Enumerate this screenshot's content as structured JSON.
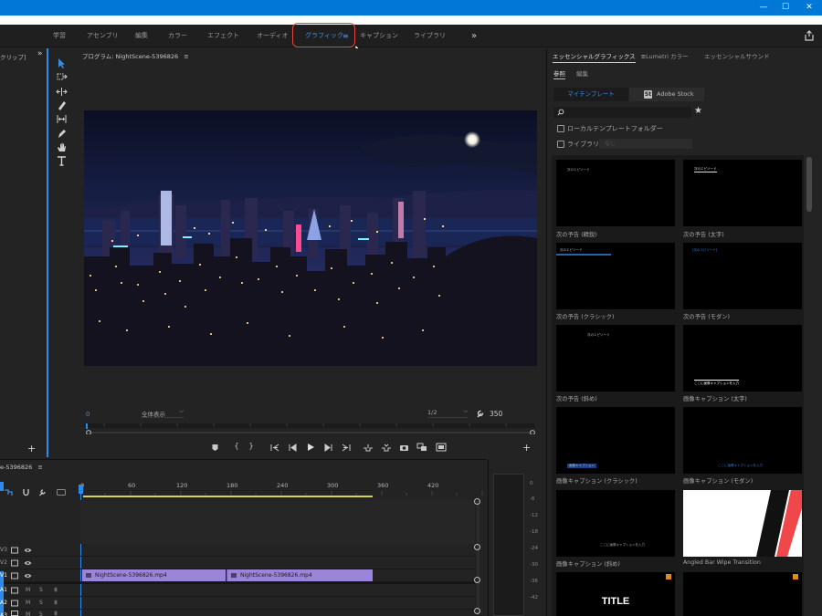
{
  "window": {
    "minimize": "—",
    "maximize": "☐",
    "close": "✕"
  },
  "workspaces": {
    "items": [
      "学習",
      "アセンブリ",
      "編集",
      "カラー",
      "エフェクト",
      "オーディオ",
      "グラフィック",
      "キャプション",
      "ライブラリ"
    ],
    "active_index": 6,
    "active_menu_glyph": "≡",
    "more": "»"
  },
  "project": {
    "title": "クリップ]",
    "more": "»",
    "add": "+"
  },
  "program": {
    "title": "プログラム: NightScene-5396826",
    "menu_glyph": "≡",
    "timecode": "0",
    "fit": "全体表示",
    "resolution": "1/2",
    "frames": "350",
    "add": "+"
  },
  "essential_graphics": {
    "tabs": [
      "エッセンシャルグラフィックス",
      "Lumetri カラー",
      "エッセンシャルサウンド"
    ],
    "tab_menu_glyph": "≡",
    "subtabs": [
      "参照",
      "編集"
    ],
    "my_templates": "マイテンプレート",
    "adobe_stock": "Adobe Stock",
    "stock_letter": "St",
    "local_folder": "ローカルテンプレートフォルダー",
    "libraries": "ライブラリ",
    "library_placeholder": "なし",
    "templates": [
      {
        "label": "次の予告 (精鋭)",
        "inner": "次のエピソード"
      },
      {
        "label": "次の予告 (太字)",
        "inner": "次のエピソード"
      },
      {
        "label": "次の予告 (クラシック)",
        "inner": "次のエピソード"
      },
      {
        "label": "次の予告 (モダン)",
        "inner": "[次のエピソード]"
      },
      {
        "label": "次の予告 (斜め)",
        "inner": "次のエピソード"
      },
      {
        "label": "画像キャプション (太字)",
        "inner": "ここに画像キャプションを入力"
      },
      {
        "label": "画像キャプション (クラシック)",
        "inner": "画像キャプション"
      },
      {
        "label": "画像キャプション (モダン)",
        "inner": "ここに画像キャプションを入力"
      },
      {
        "label": "画像キャプション (斜め)",
        "inner": "ここに画像キャプションを入力"
      },
      {
        "label": "Angled Bar Wipe Transition",
        "inner": ""
      },
      {
        "label": "",
        "inner": "TITLE"
      },
      {
        "label": "",
        "inner": ""
      }
    ]
  },
  "timeline": {
    "title": "e-5396826",
    "menu_glyph": "≡",
    "ruler": [
      "0",
      "60",
      "120",
      "180",
      "240",
      "300",
      "360",
      "420"
    ],
    "tracks": [
      {
        "id": "V3",
        "mute": "",
        "solo": ""
      },
      {
        "id": "V2",
        "mute": "",
        "solo": ""
      },
      {
        "id": "V1",
        "mute": "",
        "solo": ""
      },
      {
        "id": "A1",
        "mute": "M",
        "solo": "S"
      },
      {
        "id": "A2",
        "mute": "M",
        "solo": "S"
      },
      {
        "id": "A3",
        "mute": "M",
        "solo": "S"
      }
    ],
    "clips": [
      "NightScene-5396826.mp4",
      "NightScene-5396826.mp4"
    ]
  },
  "meters": {
    "scale": [
      "0",
      "-6",
      "-12",
      "-18",
      "-24",
      "-30",
      "-36",
      "-42"
    ]
  },
  "colors": {
    "accent": "#2d8ceb",
    "clip": "#9b85d8",
    "workarea": "#d8d44a",
    "highlight": "#e0443a"
  }
}
